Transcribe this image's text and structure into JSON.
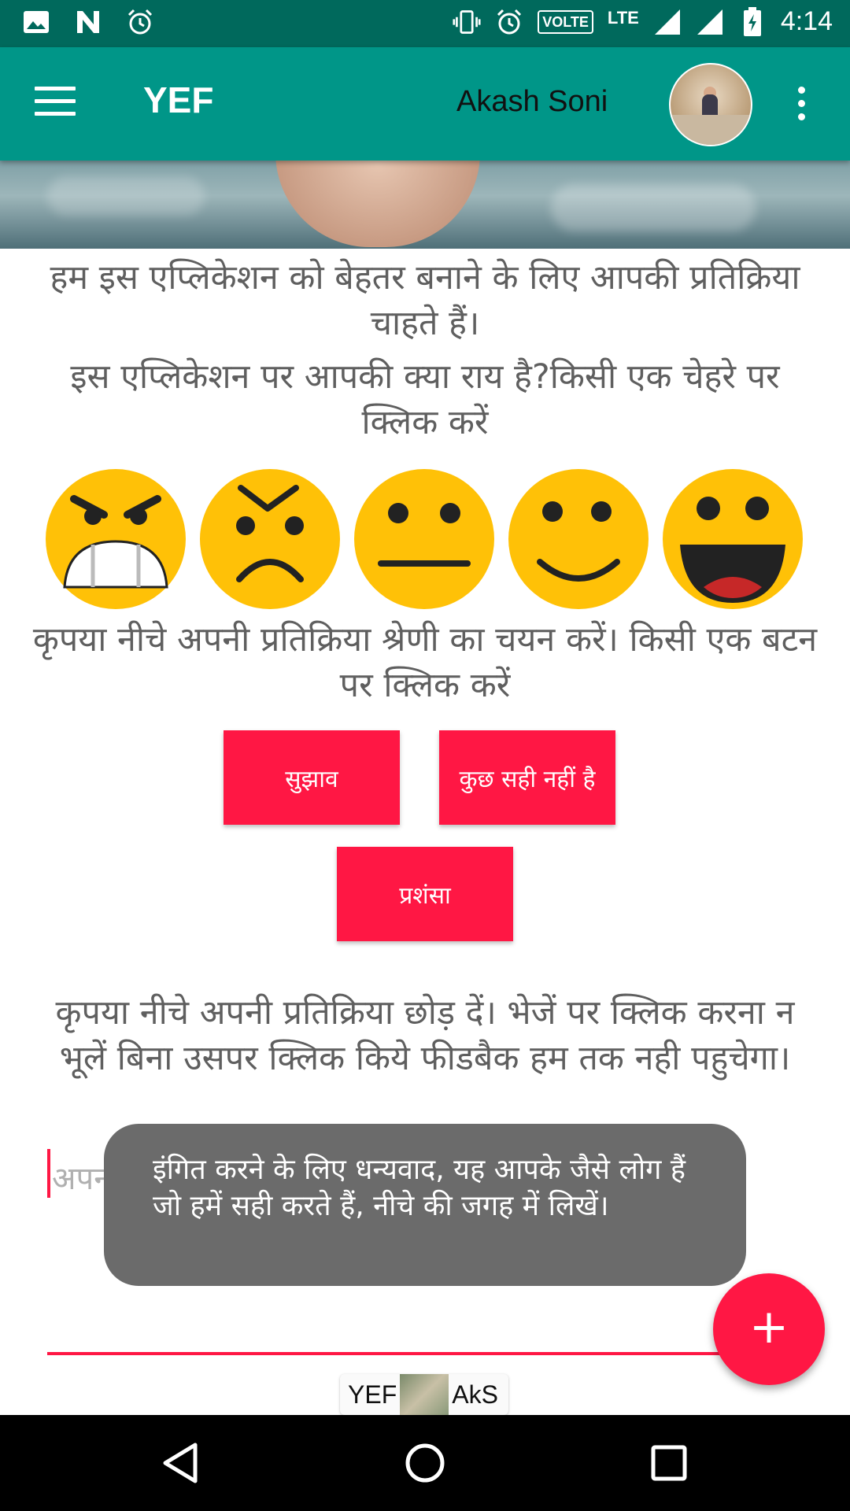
{
  "status_bar": {
    "time": "4:14",
    "network": "LTE",
    "volte": "VOLTE",
    "icons": [
      "image-icon",
      "n-icon",
      "alarm-icon",
      "vibrate-icon",
      "alarm-icon",
      "signal-icon",
      "signal-icon",
      "battery-charging-icon"
    ]
  },
  "app_bar": {
    "title": "YEF",
    "user_name": "Akash Soni",
    "icons": [
      "menu-icon",
      "avatar",
      "more-vert-icon"
    ]
  },
  "feedback": {
    "intro": "हम इस एप्लिकेशन को बेहतर बनाने के लिए आपकी प्रतिक्रिया चाहते हैं।",
    "question": "इस एप्लिकेशन पर आपकी क्या राय है?किसी एक चेहरे पर क्लिक करें",
    "faces": [
      "very-angry",
      "angry",
      "neutral",
      "happy",
      "very-happy"
    ],
    "category_prompt": "कृपया नीचे अपनी प्रतिक्रिया श्रेणी का चयन करें। किसी एक बटन पर क्लिक करें",
    "buttons": {
      "suggestion": "सुझाव",
      "something_wrong": "कुछ सही नहीं है",
      "praise": "प्रशंसा"
    },
    "leave_prompt": "कृपया नीचे अपनी प्रतिक्रिया छोड़ दें। भेजें पर क्लिक करना न भूलें  बिना उसपर क्लिक किये फीडबैक हम तक नही पहुचेगा।",
    "input_placeholder": "अपनी प्रतिक्रिया"
  },
  "toast": {
    "message": "इंगित करने के लिए धन्यवाद, यह आपके जैसे लोग हैं जो हमें सही करते हैं, नीचे की जगह में लिखें।"
  },
  "fab": {
    "label": "+"
  },
  "footer_chip": {
    "left": "YEF",
    "right": "AkS"
  },
  "colors": {
    "status_bar": "#00695c",
    "app_bar": "#009688",
    "accent": "#ff1744",
    "face_yellow": "#ffc107",
    "toast_bg": "#6b6b6b"
  }
}
